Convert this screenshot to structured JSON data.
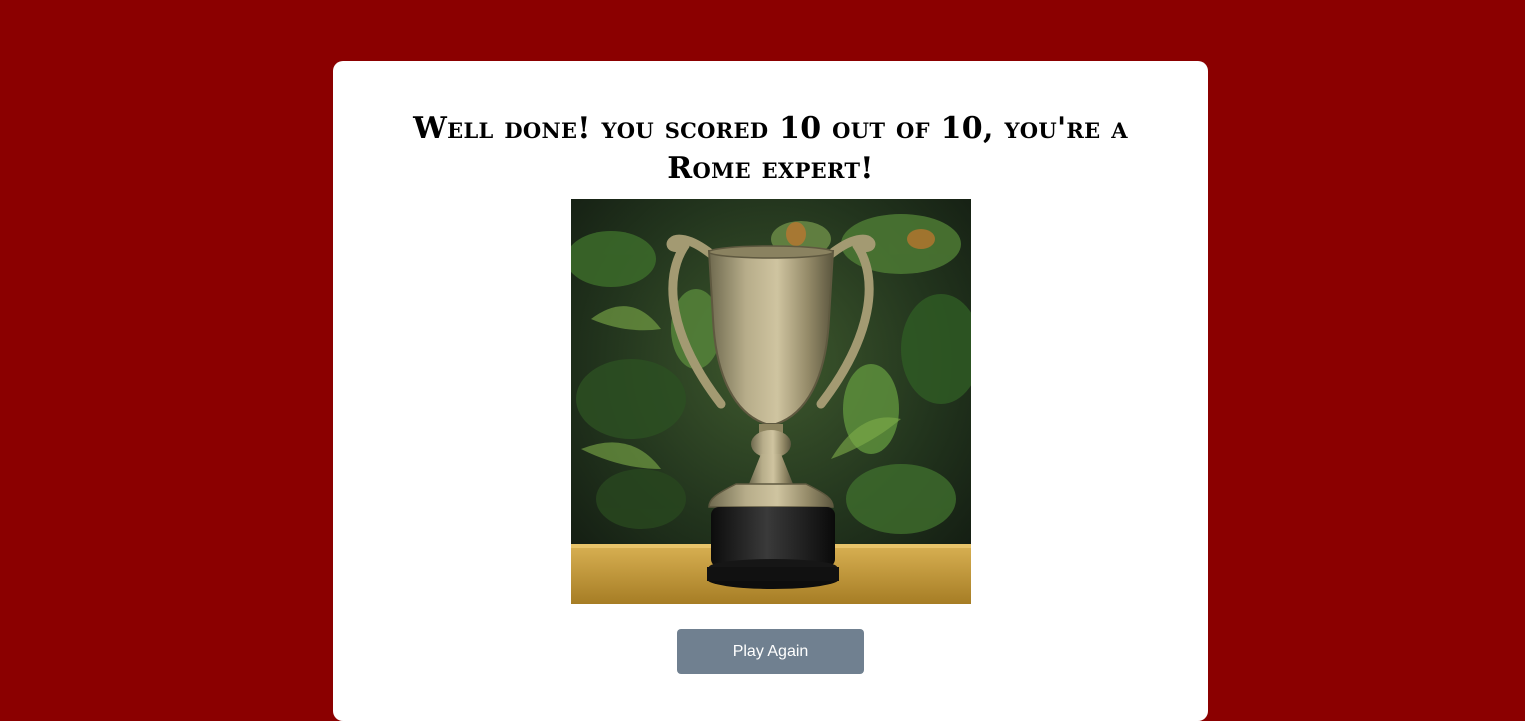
{
  "result": {
    "title": "Well done! you scored 10 out of 10, you're a Rome expert!"
  },
  "image": {
    "subject": "trophy-cup"
  },
  "buttons": {
    "play_again_label": "Play Again"
  },
  "colors": {
    "page_background": "#8b0000",
    "card_background": "#ffffff",
    "button_background": "#708090",
    "button_text": "#ffffff"
  }
}
